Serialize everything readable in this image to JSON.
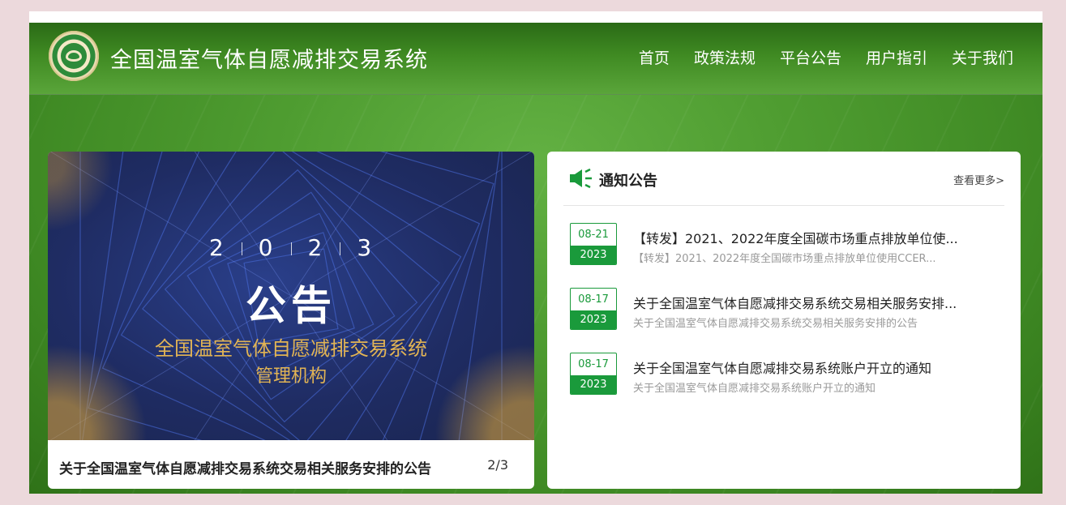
{
  "header": {
    "site_title": "全国温室气体自愿减排交易系统",
    "nav": [
      "首页",
      "政策法规",
      "平台公告",
      "用户指引",
      "关于我们"
    ]
  },
  "banner": {
    "year_digits": [
      "2",
      "0",
      "2",
      "3"
    ],
    "heading": "公告",
    "subtitle_line1": "全国温室气体自愿减排交易系统",
    "subtitle_line2": "管理机构",
    "caption": "关于全国温室气体自愿减排交易系统交易相关服务安排的公告",
    "page_indicator": "2/3"
  },
  "notices": {
    "title": "通知公告",
    "more_label": "查看更多>",
    "items": [
      {
        "date": "08-21",
        "year": "2023",
        "title": "【转发】2021、2022年度全国碳市场重点排放单位使...",
        "summary": "【转发】2021、2022年度全国碳市场重点排放单位使用CCER..."
      },
      {
        "date": "08-17",
        "year": "2023",
        "title": "关于全国温室气体自愿减排交易系统交易相关服务安排...",
        "summary": "关于全国温室气体自愿减排交易系统交易相关服务安排的公告"
      },
      {
        "date": "08-17",
        "year": "2023",
        "title": "关于全国温室气体自愿减排交易系统账户开立的通知",
        "summary": "关于全国温室气体自愿减排交易系统账户开立的通知"
      }
    ]
  },
  "colors": {
    "brand_green": "#1a9a3b",
    "gold": "#e2b454"
  }
}
